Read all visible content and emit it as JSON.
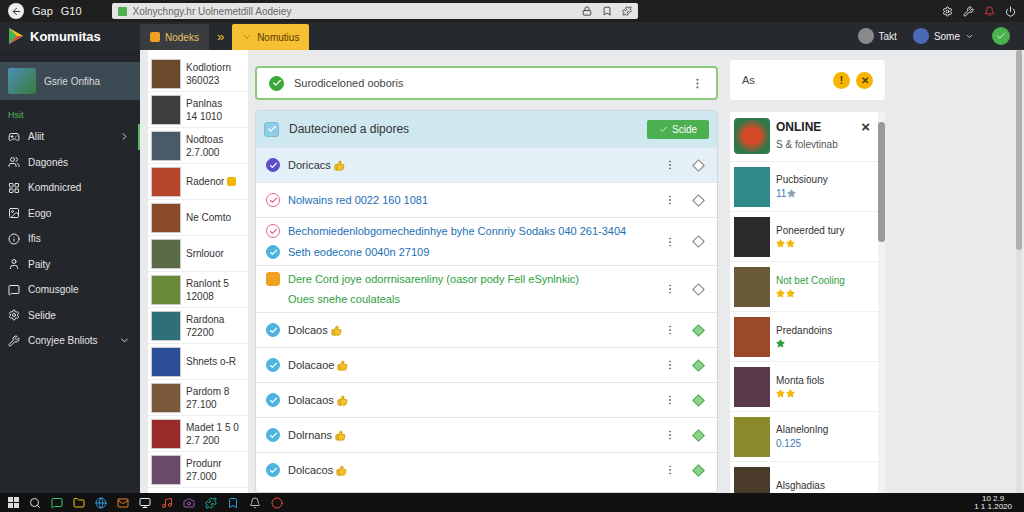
{
  "browser": {
    "labels": [
      "Gap",
      "G10"
    ],
    "address": "Xolnychngy.hr Uolnemetdill Aodeiey"
  },
  "app": {
    "name": "Komumitas"
  },
  "nav": {
    "tabs": [
      {
        "label": "Nodeks",
        "selected": false
      },
      {
        "label": "Nomutius",
        "selected": true
      }
    ],
    "separator": "»",
    "users": [
      "Takt",
      "Some"
    ]
  },
  "sidebar": {
    "profile": {
      "label": "Gsrie Onfiha",
      "selected": true
    },
    "section": "Hsit",
    "items": [
      {
        "label": "Aliit",
        "selected": true,
        "expandable": true,
        "expanded": false
      },
      {
        "label": "Dagonés",
        "selected": false,
        "expandable": false,
        "expanded": false
      },
      {
        "label": "Komdnicred",
        "selected": false,
        "expandable": false,
        "expanded": false
      },
      {
        "label": "Eogo",
        "selected": false,
        "expandable": false,
        "expanded": false
      },
      {
        "label": "Ifis",
        "selected": false,
        "expandable": false,
        "expanded": false
      },
      {
        "label": "Paity",
        "selected": false,
        "expandable": false,
        "expanded": false
      },
      {
        "label": "Comusgole",
        "selected": false,
        "expandable": false,
        "expanded": false
      },
      {
        "label": "Selide",
        "selected": false,
        "expandable": false,
        "expanded": false
      },
      {
        "label": "Conyjee Bnliots",
        "selected": false,
        "expandable": true,
        "expanded": true
      }
    ]
  },
  "friends": [
    {
      "name": "Kodlotiorn",
      "number": "360023",
      "badge": false
    },
    {
      "name": "Panlnas",
      "number": "14 1010",
      "badge": false
    },
    {
      "name": "Nodtoas",
      "number": "2.7.000",
      "badge": false
    },
    {
      "name": "Radenor",
      "badge": true
    },
    {
      "name": "Ne Comto",
      "badge": false
    },
    {
      "name": "Srnlouor",
      "badge": false
    },
    {
      "name": "Ranlont 5",
      "number": "12008",
      "badge": false
    },
    {
      "name": "Rardona",
      "number": "72200",
      "badge": false
    },
    {
      "name": "Shnets o-R",
      "badge": false
    },
    {
      "name": "Pardom 8",
      "number": "27.100",
      "badge": false
    },
    {
      "name": "Madet 1 5 0",
      "number": "2.7 200",
      "badge": false
    },
    {
      "name": "Produnr",
      "number": "27.000",
      "badge": false
    }
  ],
  "status_card": {
    "label": "Surodiceloned ooboris",
    "checked": true
  },
  "list": {
    "header": "Dautecioned a dipores",
    "header_checked": true,
    "button": "Scide",
    "rows": [
      {
        "lines": [
          {
            "text": "Doricacs",
            "icon": "check",
            "color": "#5b4fc9",
            "text_color": "#333333"
          }
        ],
        "liked": true,
        "selected": true,
        "done": false
      },
      {
        "lines": [
          {
            "text": "Nolwains red 0022 160 1081",
            "icon": "circle",
            "color": "#e85c9a",
            "text_color": "#1a6fb5"
          }
        ],
        "liked": false,
        "selected": false,
        "done": false
      },
      {
        "lines": [
          {
            "text": "Bechomiedenlobgomechedinhye byhe Connriy Sodaks 040 261-3404",
            "icon": "circle",
            "color": "#e85c9a",
            "text_color": "#1a6fb5"
          },
          {
            "text": "Seth eodecone 0040n 27109",
            "icon": "check",
            "color": "#4fb3e0",
            "text_color": "#1a6fb5"
          }
        ],
        "liked": false,
        "selected": false,
        "done": false
      },
      {
        "lines": [
          {
            "text": "Dere Cord joye odorrnisarenliny (oasor pody Fell eSynlnkic)",
            "icon": "square",
            "color": "#f0a020",
            "text_color": "#2e9e3e"
          },
          {
            "text": "Oues snehe coulateals",
            "text_color": "#2e9e3e"
          }
        ],
        "liked": false,
        "selected": false,
        "done": false
      },
      {
        "lines": [
          {
            "text": "Dolcaos",
            "icon": "check",
            "color": "#4fb3e0",
            "text_color": "#333333"
          }
        ],
        "liked": true,
        "selected": false,
        "done": true
      },
      {
        "lines": [
          {
            "text": "Dolacaoe",
            "icon": "check",
            "color": "#4fb3e0",
            "text_color": "#333333"
          }
        ],
        "liked": true,
        "selected": false,
        "done": true
      },
      {
        "lines": [
          {
            "text": "Dolacaos",
            "icon": "check",
            "color": "#4fb3e0",
            "text_color": "#333333"
          }
        ],
        "liked": true,
        "selected": false,
        "done": true
      },
      {
        "lines": [
          {
            "text": "Dolrnans",
            "icon": "check",
            "color": "#4fb3e0",
            "text_color": "#333333"
          }
        ],
        "liked": true,
        "selected": false,
        "done": true
      },
      {
        "lines": [
          {
            "text": "Dolcacos",
            "icon": "check",
            "color": "#4fb3e0",
            "text_color": "#333333"
          }
        ],
        "liked": true,
        "selected": false,
        "done": true
      }
    ]
  },
  "side_card": {
    "label": "As",
    "badges": [
      "!",
      "✕"
    ]
  },
  "online": {
    "title": "ONLINE",
    "close": "×",
    "subtitle": "S & folevtinab",
    "items": [
      {
        "name": "Pucbsiouny",
        "count": "11",
        "stars": 1,
        "star_color": "#8fa3b5",
        "color": "#333333"
      },
      {
        "name": "Poneerded tury",
        "stars": 2,
        "star_color": "#f2b705",
        "color": "#333333"
      },
      {
        "name": "Not bet Cooling",
        "stars": 2,
        "star_color": "#f2b705",
        "color": "#2e9e3e"
      },
      {
        "name": "Predandoins",
        "stars": 1,
        "star_color": "#2e9e3e",
        "color": "#333333"
      },
      {
        "name": "Monta fiols",
        "stars": 2,
        "star_color": "#f2b705",
        "color": "#333333"
      },
      {
        "name": "Alanelonlng",
        "count": "0.125",
        "stars": 0,
        "star_color": "#f2b705",
        "color": "#333333"
      },
      {
        "name": "Alsghadias",
        "stars": 0,
        "star_color": "#f2b705",
        "color": "#333333"
      }
    ]
  },
  "taskbar": {
    "clock": [
      "10 2.9",
      "1 1 1.2020"
    ]
  }
}
